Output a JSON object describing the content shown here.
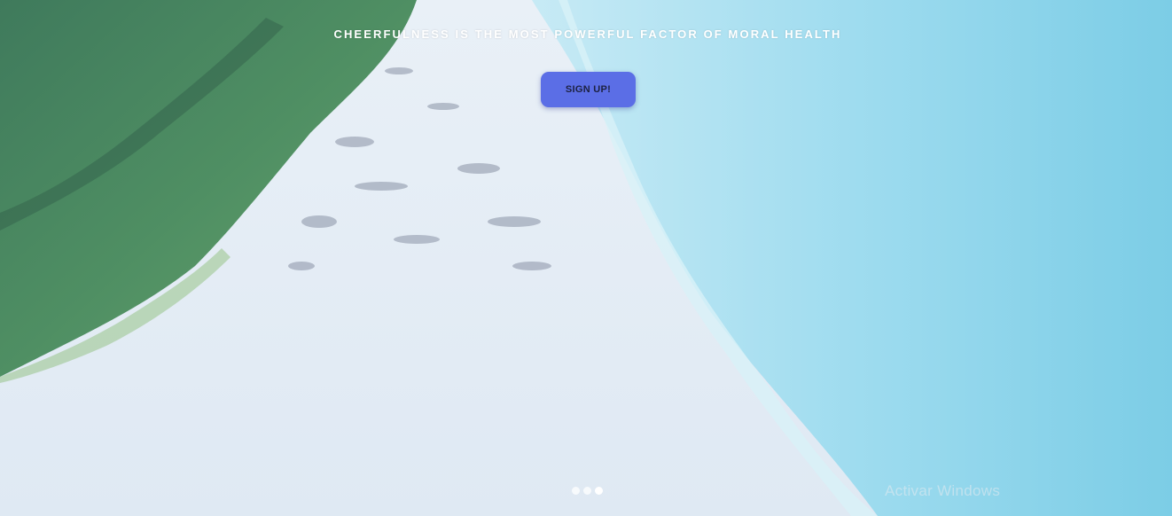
{
  "hero": {
    "tagline": "CHEERFULNESS IS THE MOST POWERFUL FACTOR OF MORAL HEALTH",
    "cta_label": "SIGN UP!",
    "cta_color": "#5b6ee6"
  },
  "carousel": {
    "slide_count": 3,
    "active_index": 2
  },
  "watermark": {
    "text": "Activar Windows"
  }
}
